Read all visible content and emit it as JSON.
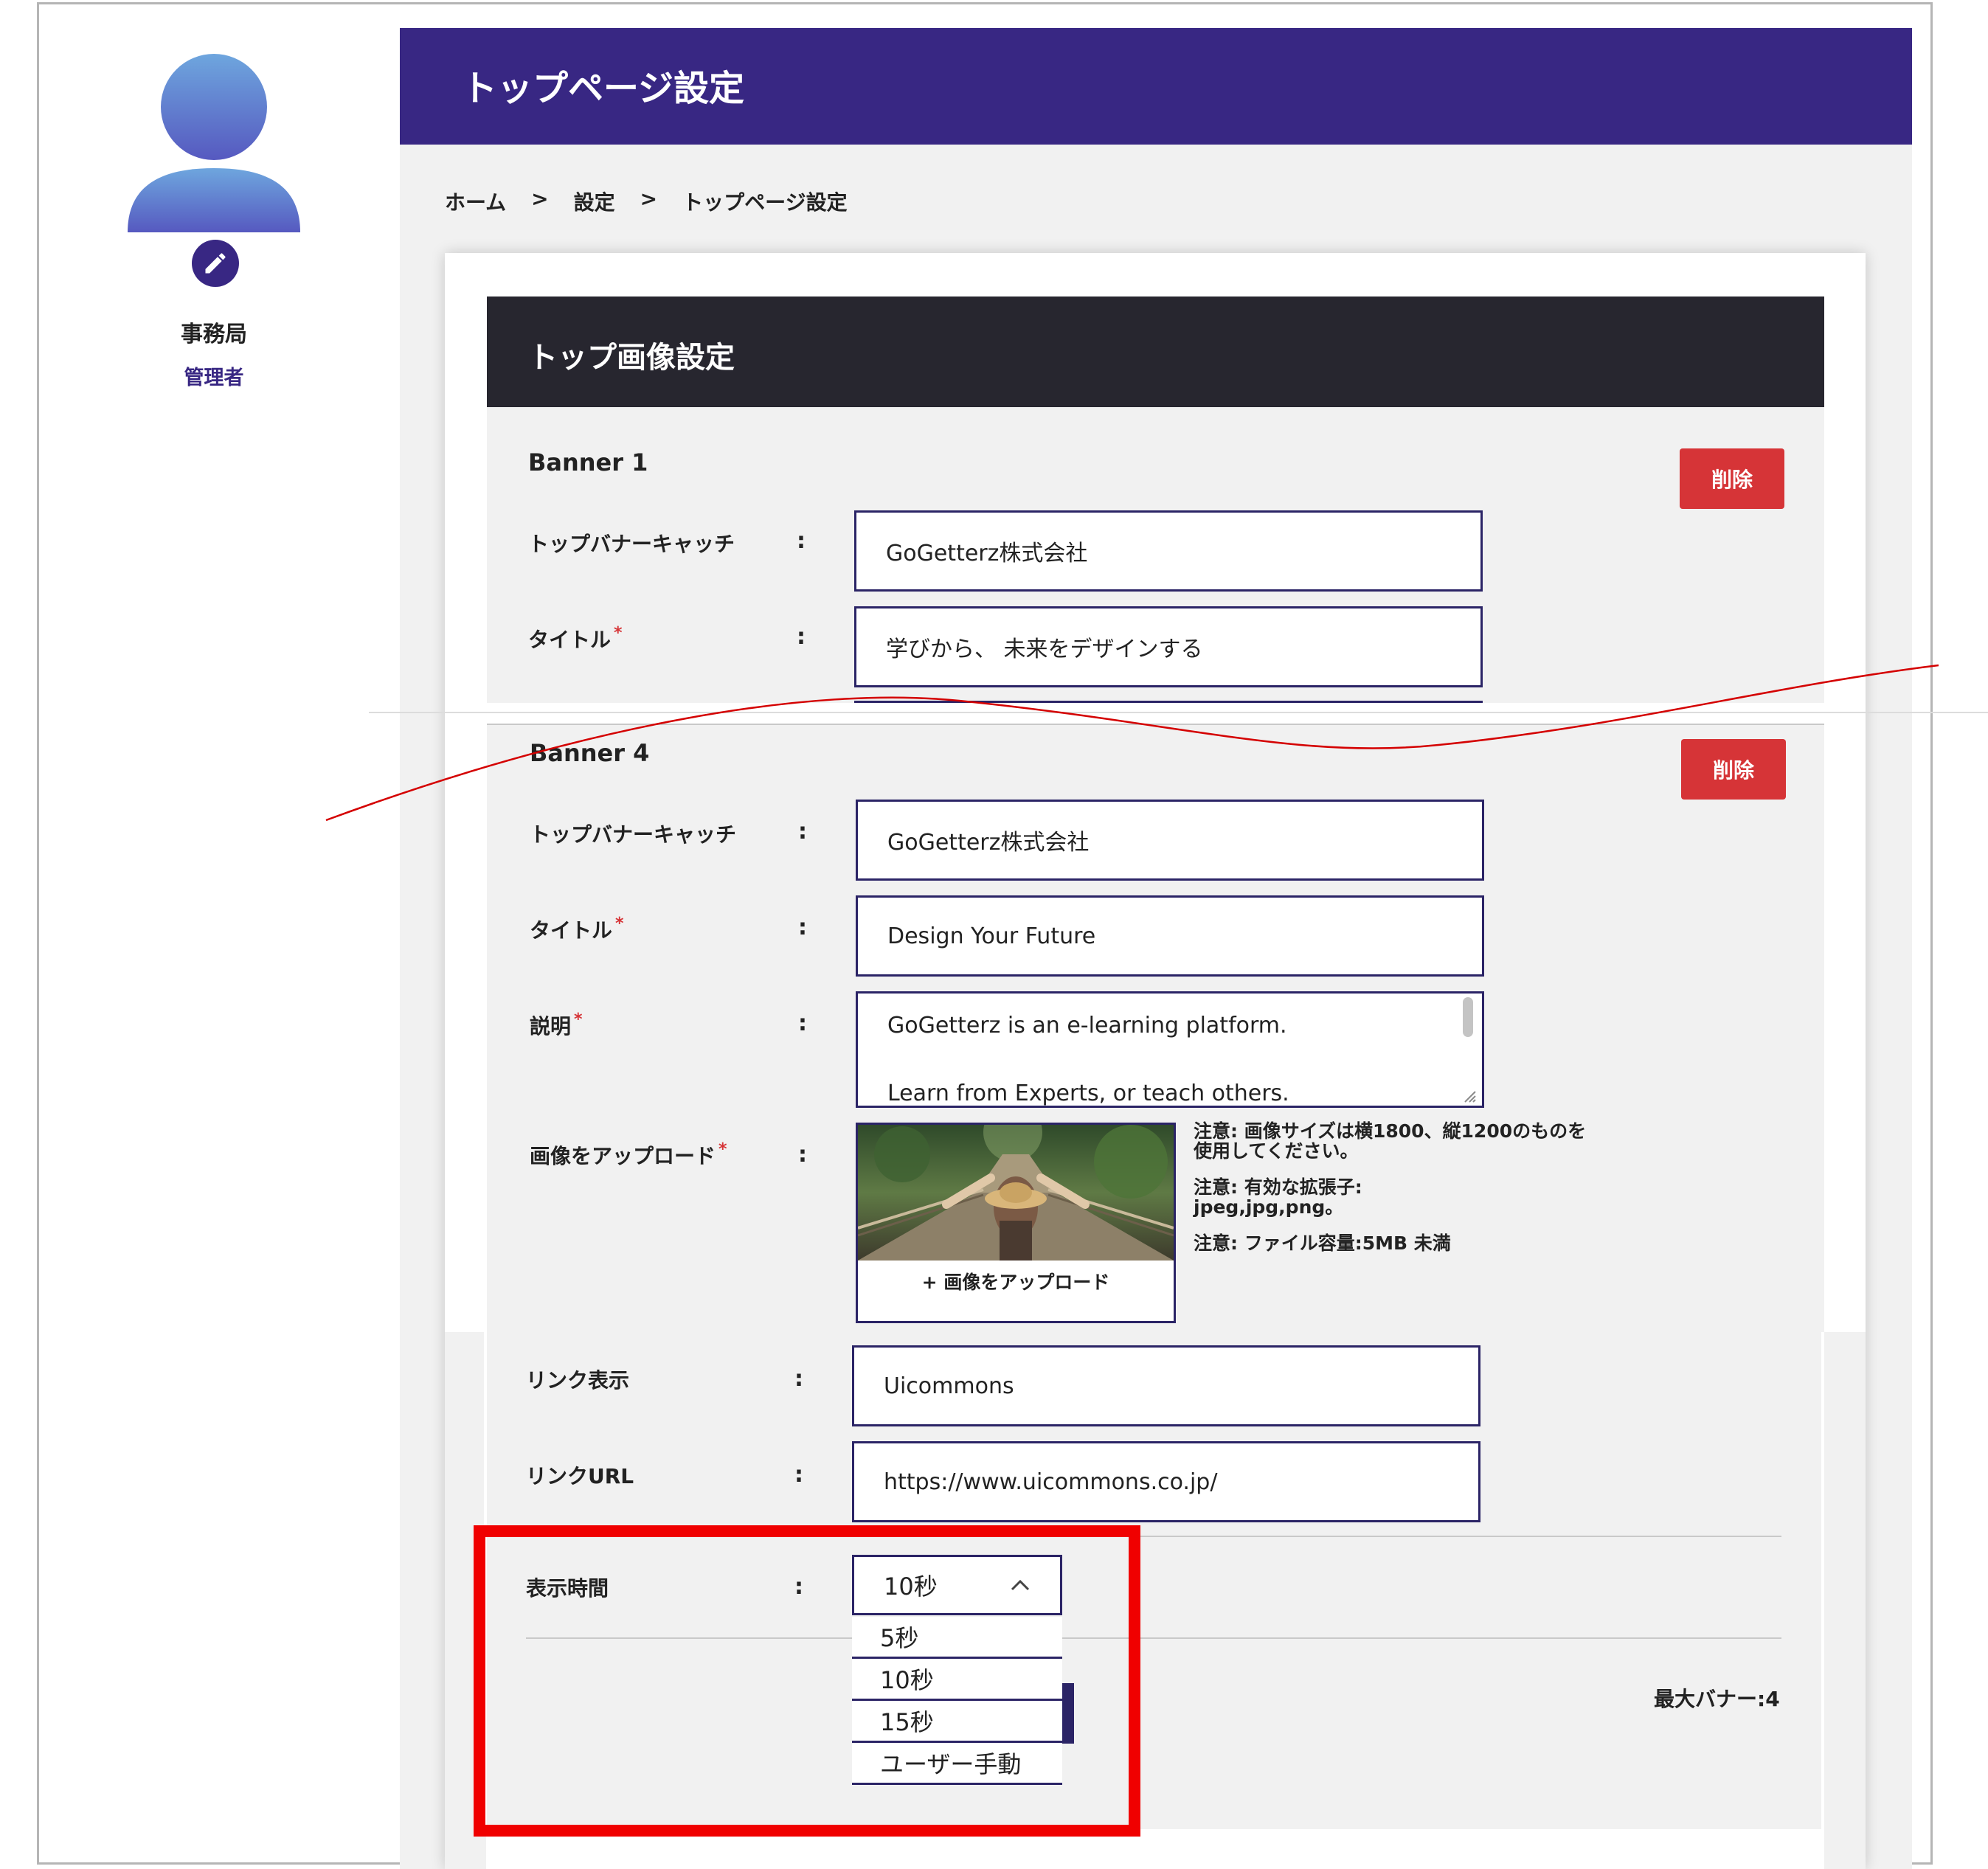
{
  "page": {
    "title": "トップページ設定"
  },
  "user": {
    "name": "事務局",
    "role": "管理者"
  },
  "breadcrumb": [
    {
      "label": "ホーム"
    },
    {
      "label": "設定"
    },
    {
      "label": "トップページ設定"
    }
  ],
  "breadcrumb_sep": ">",
  "section": {
    "title": "トップ画像設定"
  },
  "banner1": {
    "label": "Banner 1",
    "delete_label": "削除",
    "catch_label": "トップバナーキャッチ",
    "catch_value": "GoGetterz株式会社",
    "title_label": "タイトル",
    "title_value": "学びから、 未来をデザインする"
  },
  "banner4": {
    "label": "Banner 4",
    "delete_label": "削除",
    "catch_label": "トップバナーキャッチ",
    "catch_value": "GoGetterz株式会社",
    "title_label": "タイトル",
    "title_value": "Design Your Future",
    "desc_label": "説明",
    "desc_line1": "GoGetterz is an e-learning platform.",
    "desc_line2": "Learn from Experts, or teach others.",
    "upload_label": "画像をアップロード",
    "upload_button": "+ 画像をアップロード",
    "note1a": "注意: 画像サイズは横1800、縦1200のものを",
    "note1b": "使用してください。",
    "note2a": "注意: 有効な拡張子:",
    "note2b": "jpeg,jpg,png。",
    "note3": "注意: ファイル容量:5MB 未満",
    "link_text_label": "リンク表示",
    "link_text_value": "Uicommons",
    "link_url_label": "リンクURL",
    "link_url_value": "https://www.uicommons.co.jp/"
  },
  "required_mark": "*",
  "colon": ":",
  "display_time": {
    "label": "表示時間",
    "selected": "10秒",
    "options": [
      "5秒",
      "10秒",
      "15秒",
      "ユーザー手動"
    ]
  },
  "max_banner": "最大バナー:4",
  "colors": {
    "header": "#382783",
    "section_header": "#27262f",
    "delete": "#d63437",
    "input_border": "#2b2466",
    "highlight": "#f00000",
    "annotation_line": "#d40000"
  }
}
